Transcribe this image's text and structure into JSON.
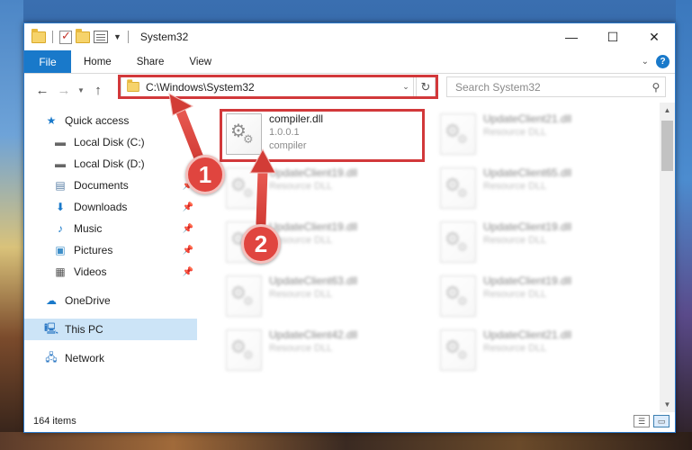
{
  "window": {
    "title": "System32",
    "controls": {
      "minimize": "—",
      "maximize": "☐",
      "close": "✕"
    }
  },
  "ribbon": {
    "tabs": [
      "File",
      "Home",
      "Share",
      "View"
    ]
  },
  "address": {
    "path": "C:\\Windows\\System32",
    "search_placeholder": "Search System32"
  },
  "nav": {
    "items": [
      {
        "label": "Quick access",
        "icon": "star-icon",
        "pinned": false,
        "selected": false
      },
      {
        "label": "Local Disk (C:)",
        "icon": "drive-icon",
        "pinned": false,
        "selected": false
      },
      {
        "label": "Local Disk (D:)",
        "icon": "drive-icon",
        "pinned": false,
        "selected": false
      },
      {
        "label": "Documents",
        "icon": "documents-icon",
        "pinned": true,
        "selected": false
      },
      {
        "label": "Downloads",
        "icon": "downloads-icon",
        "pinned": true,
        "selected": false
      },
      {
        "label": "Music",
        "icon": "music-icon",
        "pinned": true,
        "selected": false
      },
      {
        "label": "Pictures",
        "icon": "pictures-icon",
        "pinned": true,
        "selected": false
      },
      {
        "label": "Videos",
        "icon": "videos-icon",
        "pinned": true,
        "selected": false
      },
      {
        "label": "OneDrive",
        "icon": "cloud-icon",
        "pinned": false,
        "selected": false
      },
      {
        "label": "This PC",
        "icon": "computer-icon",
        "pinned": false,
        "selected": true
      },
      {
        "label": "Network",
        "icon": "network-icon",
        "pinned": false,
        "selected": false
      }
    ]
  },
  "files": {
    "highlighted": {
      "name": "compiler.dll",
      "version": "1.0.0.1",
      "description": "compiler"
    },
    "blurred_col1": [
      {
        "name": "UpdateClient19.dll",
        "type": "Resource DLL"
      },
      {
        "name": "UpdateClient19.dll",
        "type": "Resource DLL"
      },
      {
        "name": "UpdateClient63.dll",
        "type": "Resource DLL"
      },
      {
        "name": "UpdateClient42.dll",
        "type": "Resource DLL"
      }
    ],
    "blurred_col2": [
      {
        "name": "UpdateClient21.dll",
        "type": "Resource DLL"
      },
      {
        "name": "UpdateClient65.dll",
        "type": "Resource DLL"
      },
      {
        "name": "UpdateClient19.dll",
        "type": "Resource DLL"
      },
      {
        "name": "UpdateClient19.dll",
        "type": "Resource DLL"
      },
      {
        "name": "UpdateClient21.dll",
        "type": "Resource DLL"
      }
    ]
  },
  "status": {
    "item_count": "164 items"
  },
  "annotations": {
    "step1": "1",
    "step2": "2",
    "color": "#e0453f"
  }
}
